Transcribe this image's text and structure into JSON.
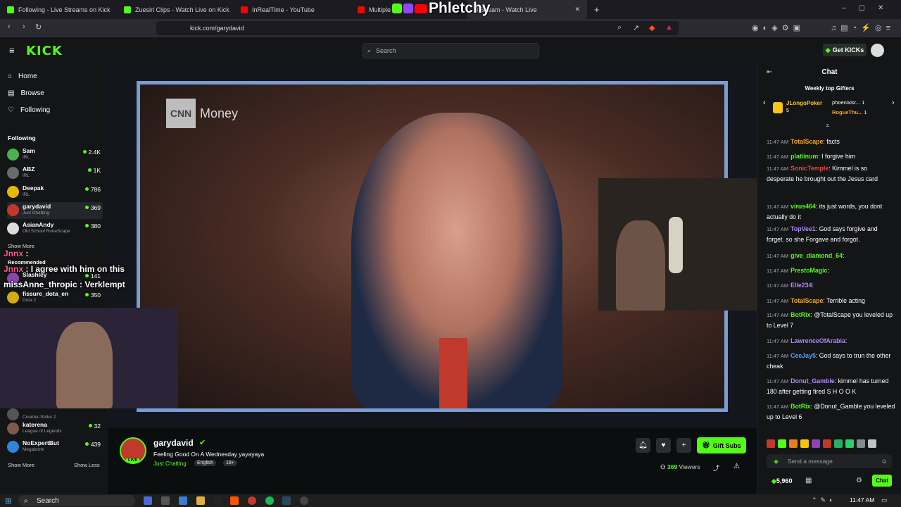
{
  "browser": {
    "tabs": [
      {
        "title": "Following - Live Streams on Kick",
        "favicon_color": "#53fc18"
      },
      {
        "title": "Zuesirl Clips - Watch Live on Kick",
        "favicon_color": "#53fc18"
      },
      {
        "title": "InRealTime - YouTube",
        "favicon_color": "#ff0000"
      },
      {
        "title": "Multiple St",
        "favicon_color": "#ff0000"
      },
      {
        "title": "d Stream - Watch Live",
        "favicon_color": "#53fc18"
      }
    ],
    "new_tab_icon": "+",
    "url": "kick.com/garydavid"
  },
  "overlay_logo": "Phletchy",
  "header": {
    "logo": "KICK",
    "search_placeholder": "Search",
    "get_kicks_label": "Get KICKs"
  },
  "sidebar": {
    "nav": [
      {
        "label": "Home",
        "icon": "home-icon"
      },
      {
        "label": "Browse",
        "icon": "browse-icon"
      },
      {
        "label": "Following",
        "icon": "heart-icon"
      }
    ],
    "following_heading": "Following",
    "following": [
      {
        "name": "Sam",
        "category": "IRL",
        "viewers": "2.4K",
        "color": "#4caf50"
      },
      {
        "name": "ABZ",
        "category": "IRL",
        "viewers": "1K",
        "color": "#6b6b6b"
      },
      {
        "name": "Deepak",
        "category": "IRL",
        "viewers": "786",
        "color": "#e6b800"
      },
      {
        "name": "garydavid",
        "category": "Just Chatting",
        "viewers": "369",
        "color": "#c0392b"
      },
      {
        "name": "AsianAndy",
        "category": "Old School RuneScape",
        "viewers": "380",
        "color": "#dcdcdc"
      }
    ],
    "show_more_1": "Show More",
    "recommended_heading": "Recommended",
    "recommended": [
      {
        "name": "Slashley",
        "category": "",
        "viewers": "141",
        "color": "#8e44ad"
      },
      {
        "name": "fissure_dota_en",
        "category": "Dota 2",
        "viewers": "350",
        "color": "#d4ac0d"
      }
    ],
    "bottom_items": [
      {
        "name": "",
        "category": "Counter-Strike 2",
        "viewers": "",
        "color": "#555"
      },
      {
        "name": "katerena",
        "category": "League of Legends",
        "viewers": "32",
        "color": "#7b5a4a"
      },
      {
        "name": "NoExpertBut",
        "category": "Megabonk",
        "viewers": "439",
        "color": "#2e86de"
      }
    ],
    "show_more_2": "Show More",
    "show_less": "Show Less"
  },
  "overlay_chat": [
    {
      "user": "Jnnx",
      "text": ""
    },
    {
      "user": "Jnnx",
      "text": "I agree with him on this"
    },
    {
      "user": "missAnne_thropic",
      "text": "Verklempt"
    }
  ],
  "video": {
    "brand": "CNN",
    "brand_text": "Money"
  },
  "stream": {
    "streamer": "garydavid",
    "live_label": "LIVE",
    "title": "Feeling Good On A Wednesday yayayaya",
    "category": "Just Chatting",
    "tags": [
      "English",
      "18+"
    ],
    "viewers": "369",
    "viewers_label": "Viewers",
    "gift_subs_label": "Gift Subs"
  },
  "chat": {
    "title": "Chat",
    "weekly_gifters_title": "Weekly top Gifters",
    "gifters": [
      {
        "name": "JLongoPoker",
        "count": "5"
      },
      {
        "name": "phoenixisr...",
        "count": "1"
      },
      {
        "name": "RogueThu...",
        "count": "1"
      }
    ],
    "messages": [
      {
        "time": "11:47 AM",
        "user": "TotalScape",
        "color": "#f5a623",
        "text": "facts"
      },
      {
        "time": "11:47 AM",
        "user": "platiinum",
        "color": "#53fc18",
        "text": "I forgive him"
      },
      {
        "time": "11:47 AM",
        "user": "SonicTemple",
        "color": "#e74c3c",
        "text": "Kimmel is so desperate he brought out the Jesus card"
      },
      {
        "time": "11:47 AM",
        "user": "virus464",
        "color": "#53fc18",
        "text": "its just words, you dont actually do it"
      },
      {
        "time": "11:47 AM",
        "user": "TopVee1",
        "color": "#b388ff",
        "text": "God says forgive and forget. so she Forgave and forgot."
      },
      {
        "time": "11:47 AM",
        "user": "give_diamond_64",
        "color": "#53fc18",
        "text": ""
      },
      {
        "time": "11:47 AM",
        "user": "PrestoMagic",
        "color": "#53fc18",
        "text": ""
      },
      {
        "time": "11:47 AM",
        "user": "Elle234",
        "color": "#b388ff",
        "text": ""
      },
      {
        "time": "11:47 AM",
        "user": "TotalScape",
        "color": "#f5a623",
        "text": "Terrible acting"
      },
      {
        "time": "11:47 AM",
        "user": "BotRix",
        "color": "#53fc18",
        "text": "@TotalScape you leveled up to Level 7"
      },
      {
        "time": "11:47 AM",
        "user": "LawrenceOfArabia",
        "color": "#b388ff",
        "text": ""
      },
      {
        "time": "11:47 AM",
        "user": "CeeJay5",
        "color": "#4fa3ff",
        "text": "God says to trun the other cheak"
      },
      {
        "time": "11:47 AM",
        "user": "Donut_Gamble",
        "color": "#b388ff",
        "text": "kimmel has turned 180 after getting fired S H O O K"
      },
      {
        "time": "11:47 AM",
        "user": "BotRix",
        "color": "#53fc18",
        "text": "@Donut_Gamble you leveled up to Level 6"
      }
    ],
    "input_placeholder": "Send a message",
    "kicks_balance": "5,960",
    "chat_button": "Chat"
  },
  "taskbar": {
    "search_label": "Search",
    "clock": "11:47 AM"
  }
}
